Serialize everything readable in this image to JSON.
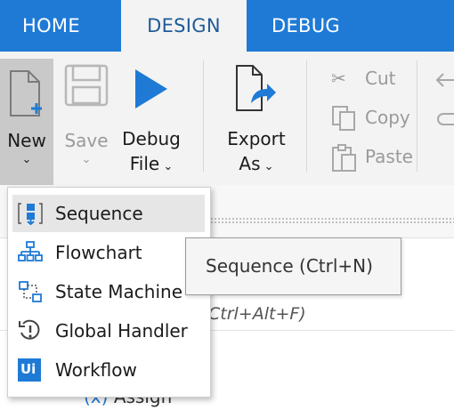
{
  "tabs": [
    {
      "label": "HOME"
    },
    {
      "label": "DESIGN"
    },
    {
      "label": "DEBUG"
    }
  ],
  "ribbon": {
    "new": {
      "label": "New",
      "icon": "new-file-icon"
    },
    "save": {
      "label": "Save",
      "icon": "save-icon"
    },
    "debug_file": {
      "line1": "Debug",
      "line2": "File",
      "icon": "play-icon"
    },
    "export": {
      "line1": "Export",
      "line2": "As",
      "icon": "export-icon"
    },
    "clipboard": [
      {
        "label": "Cut",
        "icon": "scissors-icon"
      },
      {
        "label": "Copy",
        "icon": "copy-icon"
      },
      {
        "label": "Paste",
        "icon": "paste-icon"
      }
    ]
  },
  "new_menu": {
    "items": [
      {
        "label": "Sequence",
        "icon": "sequence-icon"
      },
      {
        "label": "Flowchart",
        "icon": "flowchart-icon"
      },
      {
        "label": "State Machine",
        "icon": "state-machine-icon"
      },
      {
        "label": "Global Handler",
        "icon": "global-handler-icon"
      },
      {
        "label": "Workflow",
        "icon": "workflow-icon",
        "badge": "Ui"
      }
    ]
  },
  "tooltip": {
    "text": "Sequence (Ctrl+N)"
  },
  "background": {
    "shortcut_hint": "Ctrl+Alt+F)",
    "activity": "Assign"
  },
  "colors": {
    "accent": "#1f7ad6",
    "menu_highlight": "#e6e6e6",
    "new_group_bg": "#c9c9c9"
  }
}
